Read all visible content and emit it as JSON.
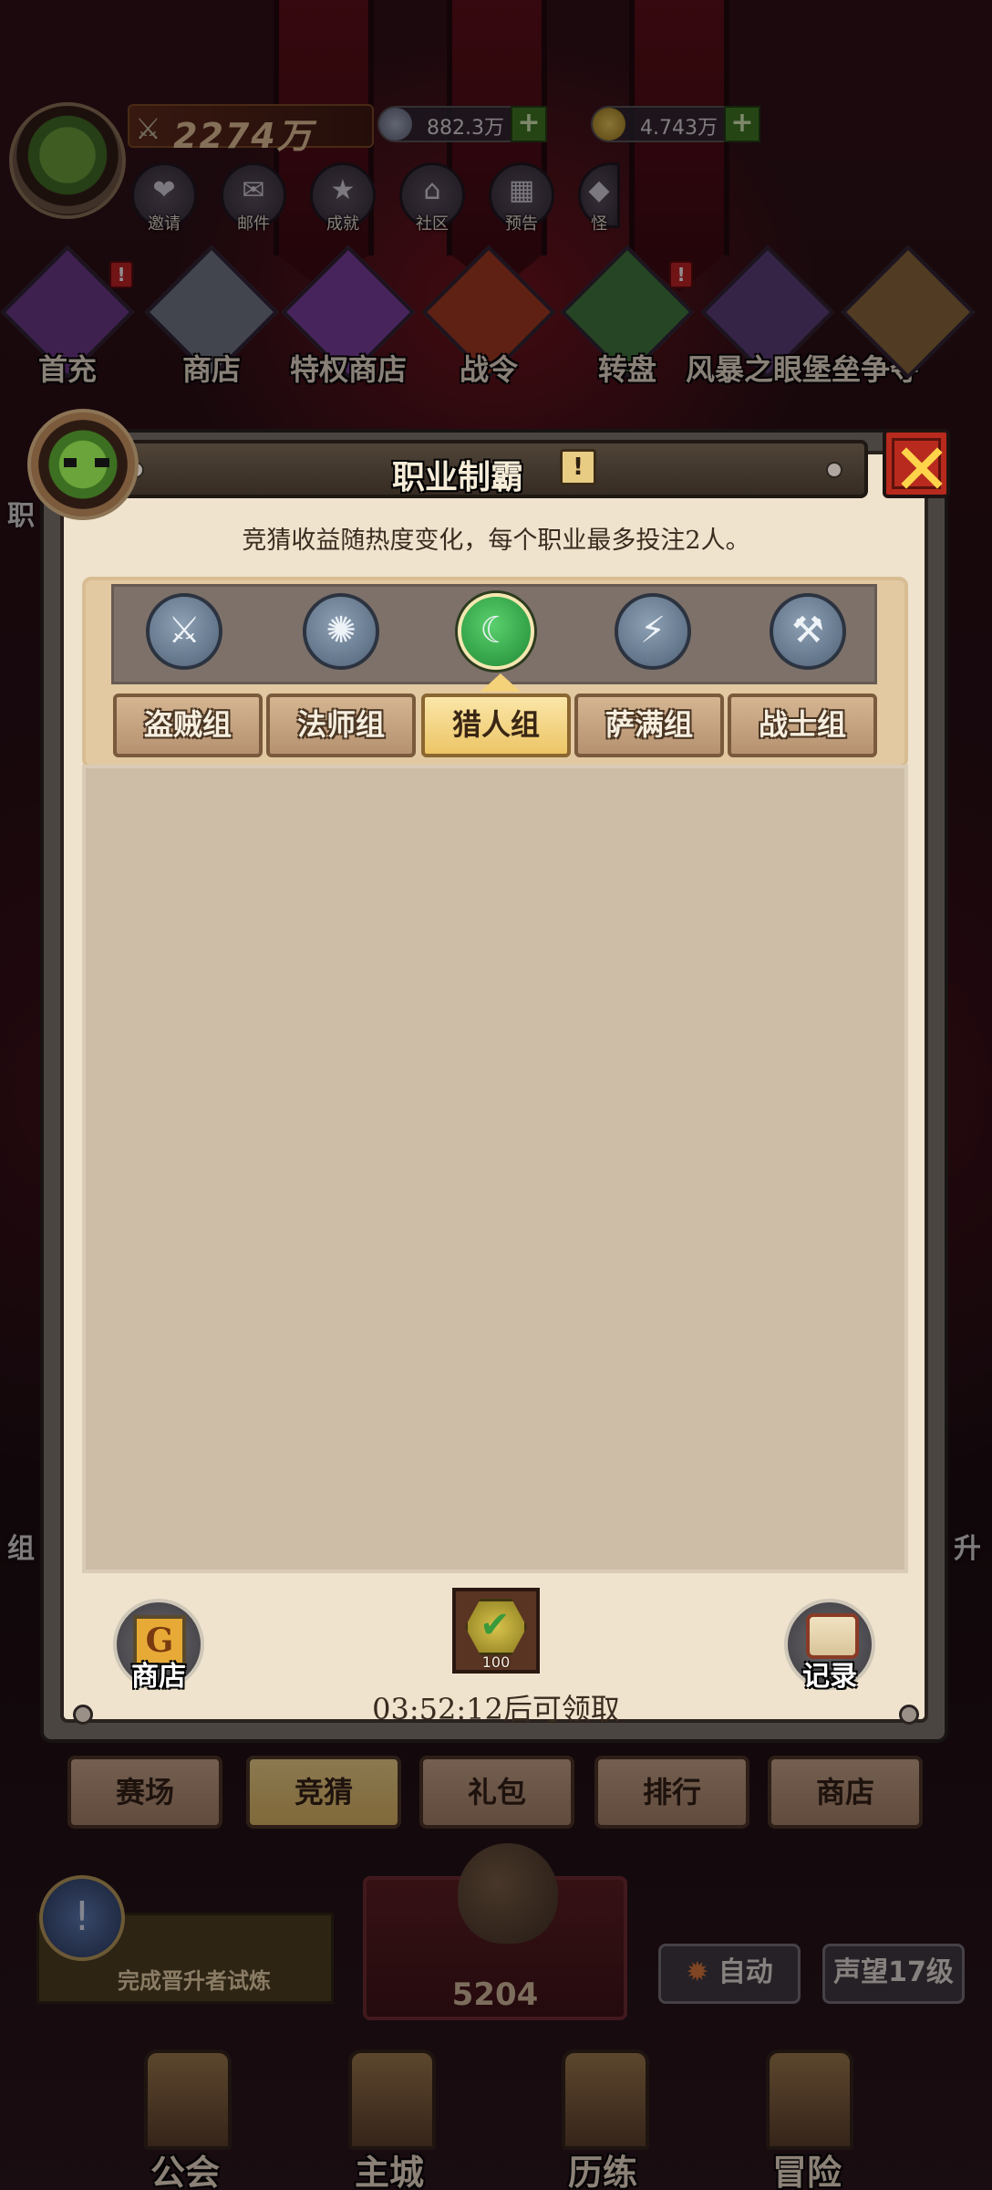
{
  "hud": {
    "power": "2274万",
    "currency_silver": "882.3万",
    "currency_gold": "4.743万",
    "plus": "+",
    "top_icons": [
      {
        "label": "邀请",
        "icon": "heart-chat-icon",
        "glyph": "❤"
      },
      {
        "label": "邮件",
        "icon": "mail-icon",
        "glyph": "✉"
      },
      {
        "label": "成就",
        "icon": "medal-icon",
        "glyph": "★"
      },
      {
        "label": "社区",
        "icon": "house-icon",
        "glyph": "⌂"
      },
      {
        "label": "预告",
        "icon": "calendar-icon",
        "glyph": "▦"
      },
      {
        "label": "怪",
        "icon": "monster-icon",
        "glyph": "◆"
      }
    ],
    "features": [
      {
        "label": "首充",
        "color": "#6b3a8a"
      },
      {
        "label": "商店",
        "color": "#707a88"
      },
      {
        "label": "特权商店",
        "color": "#7a3ea0"
      },
      {
        "label": "战令",
        "color": "#a33a1e"
      },
      {
        "label": "转盘",
        "color": "#3c7a3c"
      },
      {
        "label": "风暴之眼堡垒争夺",
        "color": "#5a3f7a"
      },
      {
        "label": "",
        "color": "#8a6a3a"
      }
    ],
    "alert": "!",
    "side_left_1": "职",
    "side_left_2": "组",
    "side_right": "升"
  },
  "background_tabs": [
    {
      "label": "赛场",
      "active": false
    },
    {
      "label": "竞猜",
      "active": true
    },
    {
      "label": "礼包",
      "active": false
    },
    {
      "label": "排行",
      "active": false
    },
    {
      "label": "商店",
      "active": false
    }
  ],
  "lower_hud": {
    "goal_text": "完成晋升者试炼",
    "bag_count": "5204",
    "auto_label": "自动",
    "reputation_label": "声望17级",
    "nav": [
      "公会",
      "主城",
      "历练",
      "冒险"
    ]
  },
  "modal": {
    "title": "职业制霸",
    "info": "!",
    "subtitle": "竞猜收益随热度变化，每个职业最多投注2人。",
    "class_icons": [
      {
        "icon": "rogue-icon",
        "glyph": "⚔",
        "active": false
      },
      {
        "icon": "mage-icon",
        "glyph": "✺",
        "active": false
      },
      {
        "icon": "hunter-icon",
        "glyph": "☾",
        "active": true
      },
      {
        "icon": "shaman-icon",
        "glyph": "⚡",
        "active": false
      },
      {
        "icon": "warrior-icon",
        "glyph": "⚒",
        "active": false
      }
    ],
    "group_tabs": [
      {
        "label": "盗贼组",
        "active": false
      },
      {
        "label": "法师组",
        "active": false
      },
      {
        "label": "猎人组",
        "active": true
      },
      {
        "label": "萨满组",
        "active": false
      },
      {
        "label": "战士组",
        "active": false
      }
    ],
    "shop_label": "商店",
    "shop_glyph": "G",
    "record_label": "记录",
    "reward_amount": "100",
    "timer_text": "03:52:12后可领取"
  }
}
